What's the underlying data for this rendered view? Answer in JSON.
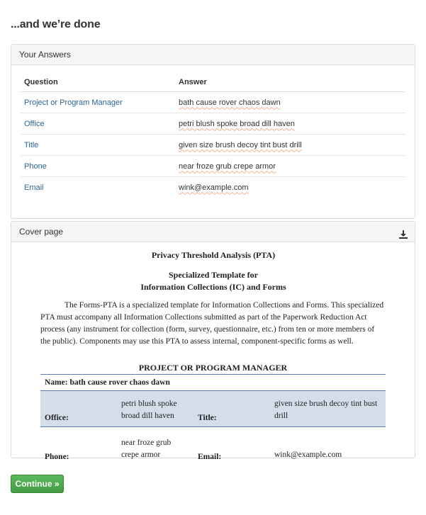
{
  "page_title": "...and we’re done",
  "answers_panel": {
    "heading": "Your Answers",
    "col_question": "Question",
    "col_answer": "Answer",
    "rows": [
      {
        "question": "Project or Program Manager",
        "answer": "bath cause rover chaos dawn"
      },
      {
        "question": "Office",
        "answer": "petri blush spoke broad dill haven"
      },
      {
        "question": "Title",
        "answer": "given size brush decoy tint bust drill"
      },
      {
        "question": "Phone",
        "answer": "near froze grub crepe armor"
      },
      {
        "question": "Email",
        "answer": "wink@example.com"
      }
    ]
  },
  "cover_panel": {
    "heading": "Cover page",
    "download_icon": "download-icon",
    "doc_title": "Privacy Threshold Analysis (PTA)",
    "doc_subtitle_1": "Specialized Template for",
    "doc_subtitle_2": "Information Collections (IC) and Forms",
    "doc_paragraph": "The Forms-PTA is a specialized template for Information Collections and Forms. This specialized PTA must accompany all Information Collections submitted as part of the Paperwork Reduction Act process (any instrument for collection (form, survey, questionnaire, etc.) from ten or more members of the public). Components may use this PTA to assess internal, component-specific forms as well.",
    "pm_table": {
      "title": "PROJECT OR PROGRAM MANAGER",
      "name_label": "Name:",
      "name_value": "bath cause rover chaos dawn",
      "office_label": "Office:",
      "office_value": "petri blush spoke broad dill haven",
      "title_label": "Title:",
      "title_value": "given size brush decoy tint bust drill",
      "phone_label": "Phone:",
      "phone_value": "near froze grub crepe armor",
      "email_label": "Email:",
      "email_value": "wink@example.com"
    }
  },
  "continue_button": "Continue »",
  "colors": {
    "link": "#2a6496",
    "button_green": "#5cb85c",
    "table_band": "#d4deea",
    "table_rule": "#5a7fa8",
    "spell_underline": "#f0b28a"
  }
}
